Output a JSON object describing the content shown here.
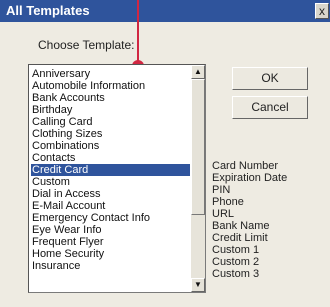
{
  "window": {
    "title": "All Templates",
    "close_glyph": "x"
  },
  "choose_label": "Choose Template:",
  "templates": [
    "Anniversary",
    "Automobile Information",
    "Bank Accounts",
    "Birthday",
    "Calling Card",
    "Clothing Sizes",
    "Combinations",
    "Contacts",
    "Credit Card",
    "Custom",
    "Dial in Access",
    "E-Mail Account",
    "Emergency Contact Info",
    "Eye Wear Info",
    "Frequent Flyer",
    "Home Security",
    "Insurance"
  ],
  "selected_template": "Credit Card",
  "buttons": {
    "ok": "OK",
    "cancel": "Cancel"
  },
  "fields": [
    "Card Number",
    "Expiration Date",
    "PIN",
    "Phone",
    "URL",
    "Bank Name",
    "Credit Limit",
    "Custom 1",
    "Custom 2",
    "Custom 3"
  ],
  "scroll_icons": {
    "up": "▲",
    "down": "▼"
  },
  "colors": {
    "title_bar": "#2f549c",
    "selection": "#2f549c",
    "annotation": "#d12742",
    "background": "#eeebe2"
  }
}
